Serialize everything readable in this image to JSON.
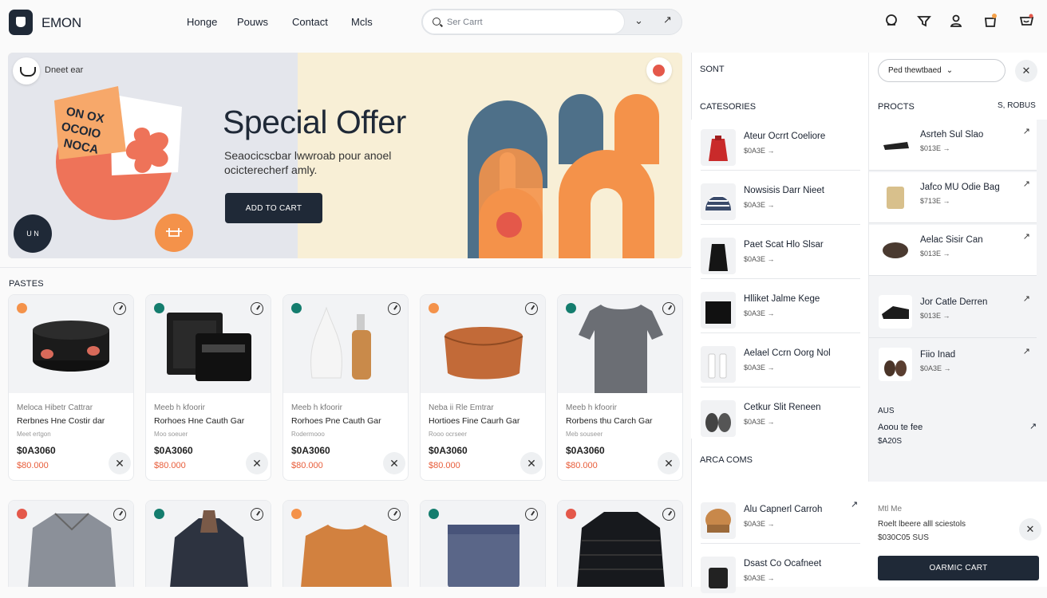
{
  "header": {
    "brand": "EMON",
    "nav": [
      "Honge",
      "Pouws",
      "Contact",
      "Mcls"
    ],
    "search_placeholder": "Ser Carrt"
  },
  "hero": {
    "tag": "Dneet ear",
    "title": "Special Offer",
    "subtitle": "Seaocicscbar lwwroab pour anoel ocicterecherf amly.",
    "button": "ADD TO CART",
    "sticker_text": "ON OX OCOIO NOCA",
    "badge_dark": "U\nN"
  },
  "products_section": {
    "label": "PASTES"
  },
  "products": [
    {
      "dot": "#f4924a",
      "meta": "Meloca Hibetr Cattrar",
      "name": "Rerbnes Hne Costir dar",
      "small": "Meet ertgon",
      "price": "$0A3060",
      "old": "$80.000"
    },
    {
      "dot": "#147d6e",
      "meta": "Meeb h kfoorir",
      "name": "Rorhoes Hne Cauth Gar",
      "small": "Moo soeuer",
      "price": "$0A3060",
      "old": "$80.000"
    },
    {
      "dot": "#147d6e",
      "meta": "Meeb h kfoorir",
      "name": "Rorhoes Pne Cauth Gar",
      "small": "Rodermooo",
      "price": "$0A3060",
      "old": "$80.000"
    },
    {
      "dot": "#f4924a",
      "meta": "Neba ii Rle Emtrar",
      "name": "Hortioes Fine Caurh Gar",
      "small": "Rooo ocrseer",
      "price": "$0A3060",
      "old": "$80.000"
    },
    {
      "dot": "#147d6e",
      "meta": "Meeb h kfoorir",
      "name": "Rorbens thu Carch Gar",
      "small": "Meb souseer",
      "price": "$0A3060",
      "old": "$80.000"
    }
  ],
  "products_row2_dots": [
    "#e4584a",
    "#147d6e",
    "#f4924a",
    "#147d6e",
    "#e4584a"
  ],
  "panel": {
    "sort_label": "SONT",
    "sort_select": "Ped thewtbaed",
    "categories_label": "CATESORIES",
    "products_label": "PROCTS",
    "products_count": "S, ROBUS",
    "categories": [
      {
        "title": "Ateur Ocrrt Coeliore",
        "price": "$0A3E →"
      },
      {
        "title": "Nowsisis Darr Nieet",
        "price": "$0A3E →"
      },
      {
        "title": "Paet Scat Hlo Slsar",
        "price": "$0A3E →"
      },
      {
        "title": "Hlliket Jalme Kege",
        "price": "$0A3E →"
      },
      {
        "title": "Aelael Ccrn Oorg Nol",
        "price": "$0A3E →"
      },
      {
        "title": "Cetkur Slit Reneen",
        "price": "$0A3E →"
      }
    ],
    "products": [
      {
        "title": "Asrteh Sul Slao",
        "price": "$013E →"
      },
      {
        "title": "Jafco MU Odie Bag",
        "price": "$713E →"
      },
      {
        "title": "Aelac Sisir Can",
        "price": "$013E →"
      },
      {
        "title": "Jor Catle Derren",
        "price": "$013E →"
      },
      {
        "title": "Fiio Inad",
        "price": "$0A3E →"
      }
    ],
    "aux": {
      "label": "AUS",
      "text": "Aoou te fee",
      "price": "$A20S"
    },
    "area_label": "ARCA COMS",
    "area_items": [
      {
        "title": "Alu Capnerl Carroh",
        "price": "$0A3E →"
      },
      {
        "title": "Dsast Co Ocafneet",
        "price": "$0A3E →"
      }
    ],
    "cart_summary": {
      "title": "Mtl Me",
      "line": "Roelt lbeere alll sciestols",
      "total": "$030C05 SUS",
      "button": "OARMIC CART"
    }
  }
}
